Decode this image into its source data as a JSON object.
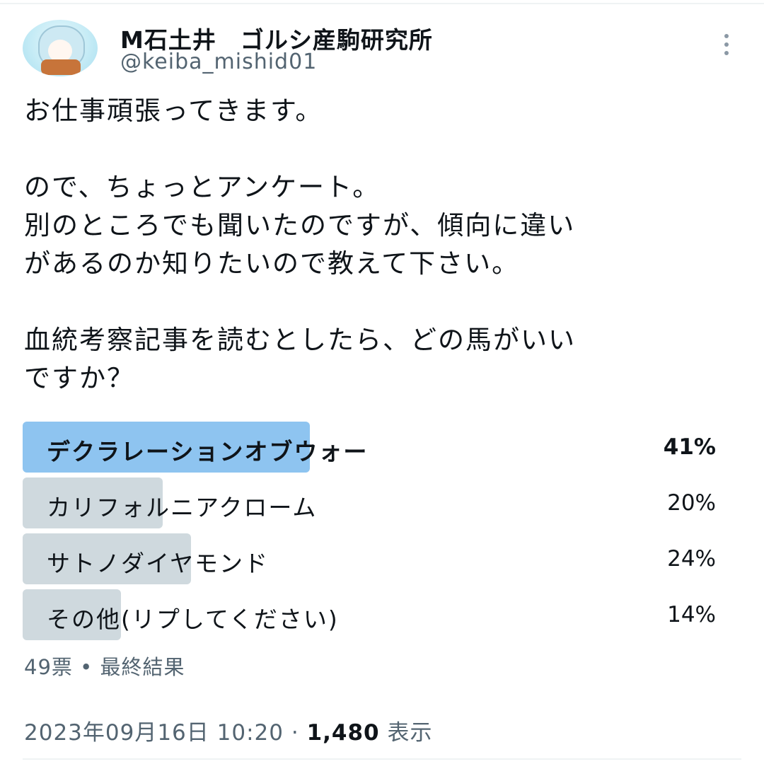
{
  "author": {
    "display_name": "M石土井　ゴルシ産駒研究所",
    "handle": "@keiba_mishid01"
  },
  "tweet": {
    "text": "お仕事頑張ってきます。\n\nので、ちょっとアンケート。\n別のところでも聞いたのですが、傾向に違い\nがあるのか知りたいので教えて下さい。\n\n血統考察記事を読むとしたら、どの馬がいい\nですか？"
  },
  "poll": {
    "options": [
      {
        "label": "デクラレーションオブウォー",
        "percent": "41%",
        "share": 41,
        "winner": true
      },
      {
        "label": "カリフォルニアクローム",
        "percent": "20%",
        "share": 20,
        "winner": false
      },
      {
        "label": "サトノダイヤモンド",
        "percent": "24%",
        "share": 24,
        "winner": false
      },
      {
        "label": "その他(リプしてください)",
        "percent": "14%",
        "share": 14,
        "winner": false
      }
    ],
    "votes": "49票",
    "separator": "•",
    "status": "最終結果"
  },
  "meta": {
    "timestamp": "2023年09月16日 10:20",
    "separator": "·",
    "views_count": "1,480",
    "views_label": "表示"
  },
  "colors": {
    "winner_fill": "#8ec4f0",
    "option_fill": "#cfd9de",
    "secondary_text": "#536471"
  },
  "icons": {
    "more": "more-vertical-icon"
  }
}
